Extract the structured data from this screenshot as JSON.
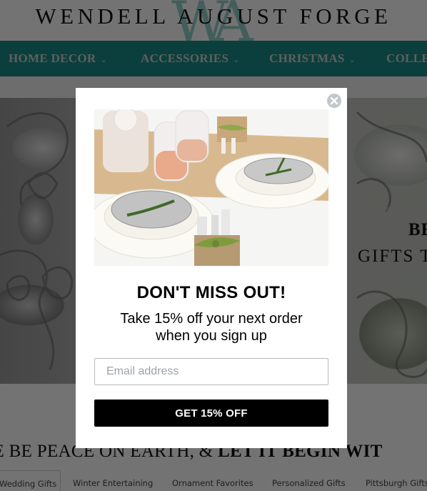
{
  "header": {
    "brand": "WENDELL AUGUST FORGE",
    "monogram": "WA"
  },
  "nav": {
    "items": [
      {
        "label": "HOME DECOR",
        "icon": "chevron-down-icon"
      },
      {
        "label": "ACCESSORIES",
        "icon": "chevron-down-icon"
      },
      {
        "label": "CHRISTMAS",
        "icon": "chevron-down-icon"
      },
      {
        "label": "COLLE"
      }
    ]
  },
  "hero": {
    "caption_line1": "BE",
    "caption_line2": "GIFTS T"
  },
  "tagline": {
    "part1": "ERE BE PEACE ON EARTH, & ",
    "part2": "LET IT BEGIN WIT"
  },
  "tabs": [
    {
      "label": "Wedding Gifts",
      "active": true
    },
    {
      "label": "Winter Entertaining"
    },
    {
      "label": "Ornament Favorites"
    },
    {
      "label": "Personalized Gifts"
    },
    {
      "label": "Pittsburgh Gifts"
    }
  ],
  "modal": {
    "close_icon": "close-icon",
    "image_alt": "Table setting with embossed aluminum plates, rosemary sprigs, wine glasses and burlap utensil holders with green bows",
    "title": "DON'T MISS OUT!",
    "subtitle_line1": "Take 15% off your next order",
    "subtitle_line2": "when you sign up",
    "email_placeholder": "Email address",
    "email_value": "",
    "cta_label": "GET 15% OFF"
  },
  "colors": {
    "nav_bg": "#1a8c87",
    "overlay": "rgba(0,0,0,0.55)",
    "cta_bg": "#000000",
    "close_bg": "#c3c7cc"
  }
}
